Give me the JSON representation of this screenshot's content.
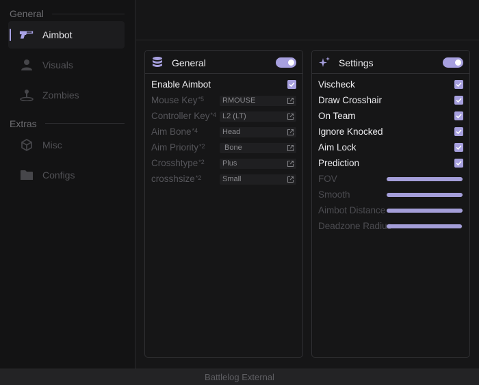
{
  "sidebar": {
    "sections": [
      {
        "title": "General",
        "items": [
          {
            "label": "Aimbot",
            "icon": "pistol-icon",
            "active": true
          },
          {
            "label": "Visuals",
            "icon": "person-icon",
            "active": false
          },
          {
            "label": "Zombies",
            "icon": "joystick-icon",
            "active": false
          }
        ]
      },
      {
        "title": "Extras",
        "items": [
          {
            "label": "Misc",
            "icon": "cube-icon",
            "active": false
          },
          {
            "label": "Configs",
            "icon": "folder-icon",
            "active": false
          }
        ]
      }
    ]
  },
  "panels": {
    "general": {
      "title": "General",
      "icon": "database-icon",
      "enabled": true,
      "enable_row": {
        "label": "Enable Aimbot",
        "checked": true
      },
      "keys": [
        {
          "label": "Mouse Key",
          "sup": "*5",
          "value": "RMOUSE"
        },
        {
          "label": "Controller Key",
          "sup": "*4",
          "value": "L2 (LT)"
        },
        {
          "label": "Aim Bone",
          "sup": "*4",
          "value": "Head"
        },
        {
          "label": "Aim Priority",
          "sup": "*2",
          "value": "Bone"
        },
        {
          "label": "Crosshtype",
          "sup": "*2",
          "value": "Plus"
        },
        {
          "label": "crosshsize",
          "sup": "*2",
          "value": "Small"
        }
      ]
    },
    "settings": {
      "title": "Settings",
      "icon": "sparkles-icon",
      "enabled": true,
      "checks": [
        {
          "label": "Vischeck",
          "checked": true
        },
        {
          "label": "Draw Crosshair",
          "checked": true
        },
        {
          "label": "On Team",
          "checked": true
        },
        {
          "label": "Ignore Knocked",
          "checked": true
        },
        {
          "label": "Aim Lock",
          "checked": true
        },
        {
          "label": "Prediction",
          "checked": true
        }
      ],
      "sliders": [
        {
          "label": "FOV",
          "value": 1.0
        },
        {
          "label": "Smooth",
          "value": 1.0
        },
        {
          "label": "Aimbot Distance",
          "value": 1.0
        },
        {
          "label": "Deadzone Radius",
          "value": 0.99
        }
      ]
    }
  },
  "footer": {
    "title": "Battlelog External"
  },
  "colors": {
    "accent": "#a7a0df",
    "background": "#161617",
    "sidebar": "#131314"
  }
}
